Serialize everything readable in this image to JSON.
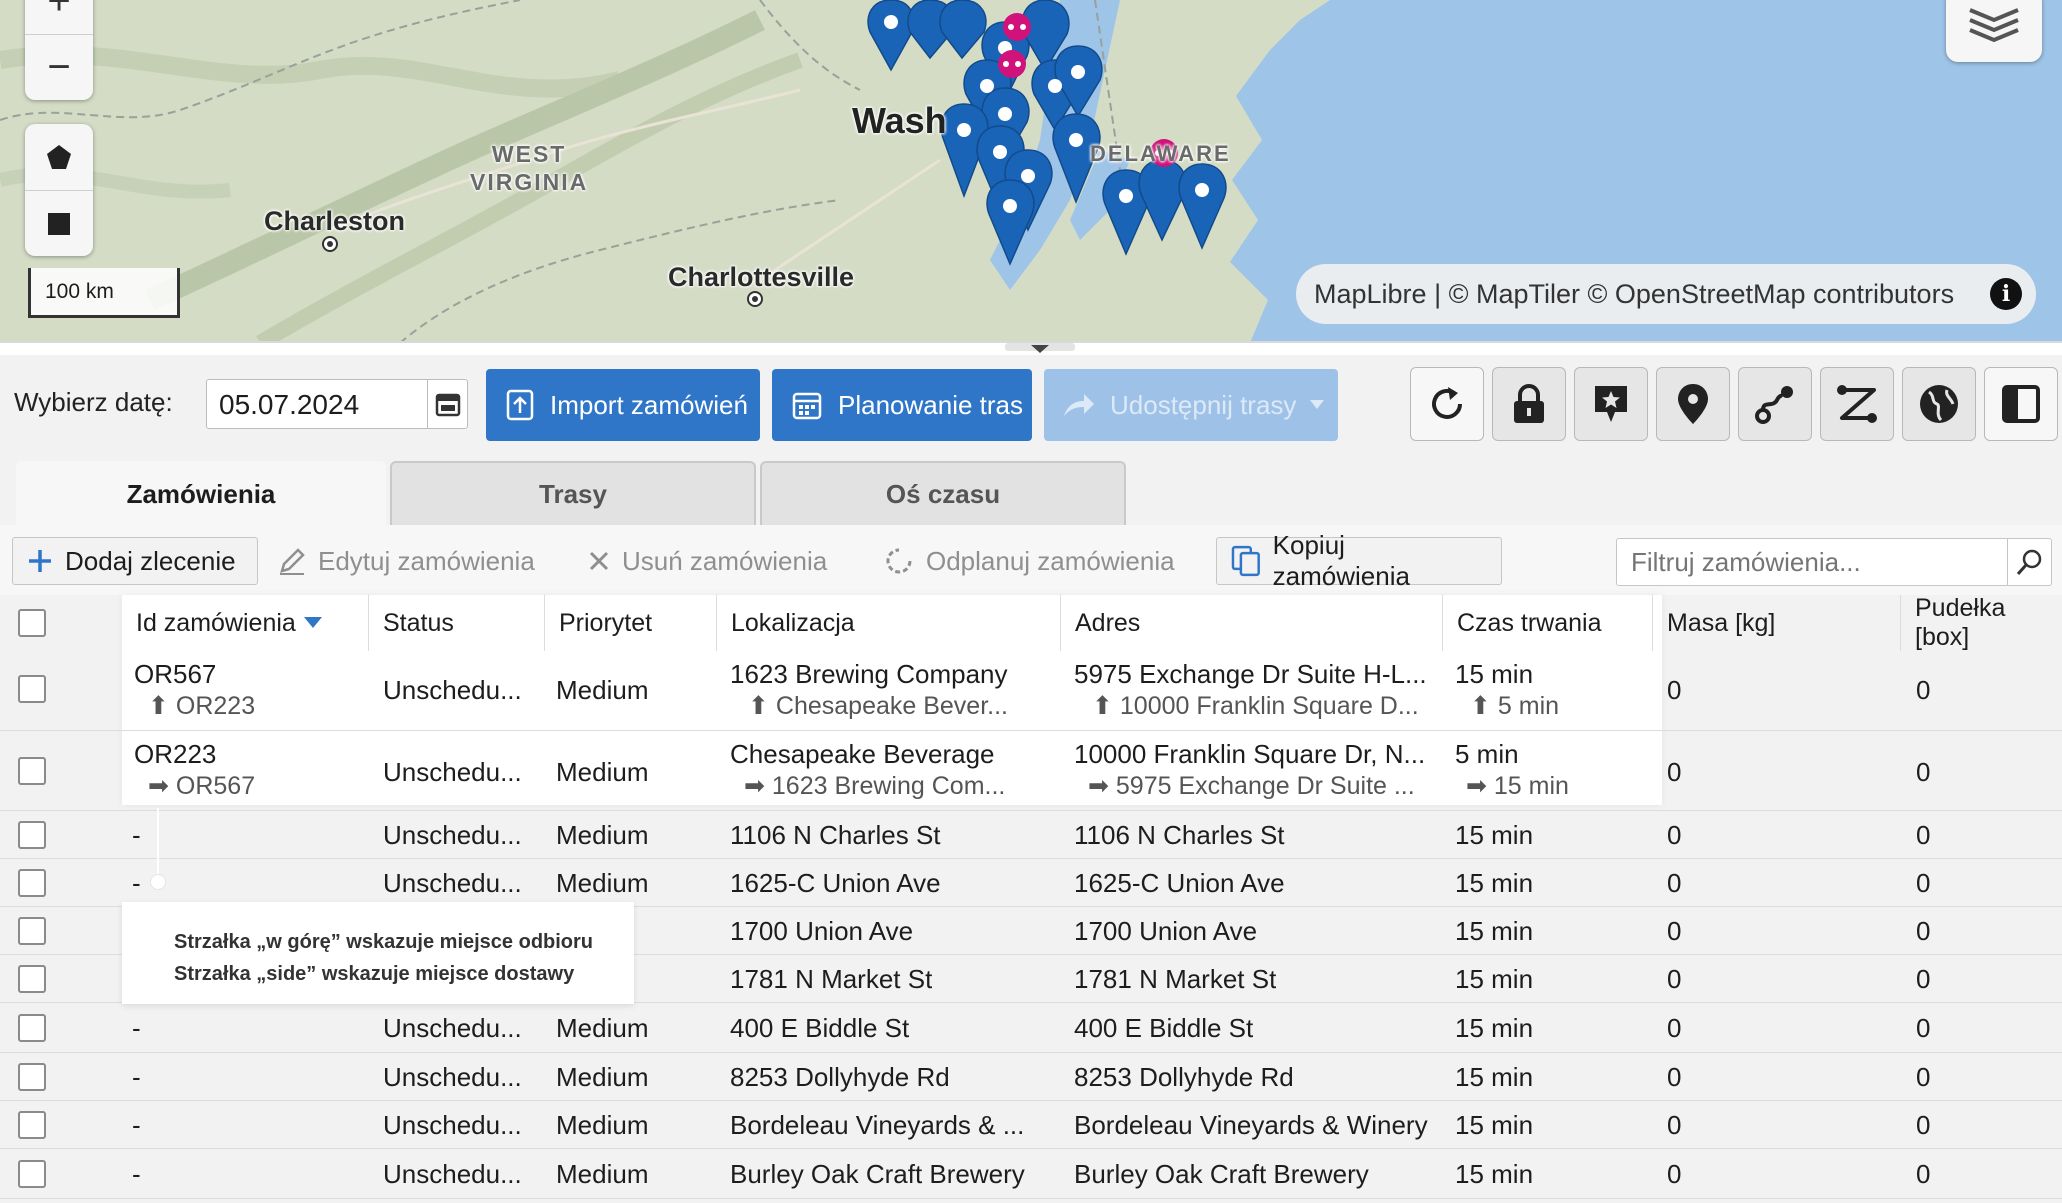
{
  "map": {
    "labels": {
      "state_wv": "WEST\nVIRGINIA",
      "charleston": "Charleston",
      "charlottesville": "Charlottesville",
      "washington": "Wash",
      "delaware": "DELAWARE"
    },
    "controls": {
      "zoom_in": "+",
      "zoom_out": "−"
    },
    "scale": "100 km",
    "attribution": "MapLibre | © MapTiler © OpenStreetMap contributors",
    "info_glyph": "i",
    "colors": {
      "water": "#9ec4e8",
      "land": "#d4dcc6",
      "pin": "#1a64b8",
      "cluster": "#d0127a"
    }
  },
  "toolbar": {
    "date_label": "Wybierz datę:",
    "date_value": "05.07.2024",
    "import_label": "Import zamówień",
    "plan_label": "Planowanie tras",
    "share_label": "Udostępnij trasy",
    "icons": [
      "refresh-icon",
      "lock-icon",
      "star-marker-icon",
      "pin-icon",
      "route-icon",
      "route-branch-icon",
      "globe-icon",
      "panel-toggle-icon"
    ]
  },
  "tabs": [
    "Zamówienia",
    "Trasy",
    "Oś czasu"
  ],
  "actions": {
    "add": "Dodaj zlecenie",
    "edit": "Edytuj zamówienia",
    "delete": "Usuń zamówienia",
    "unplan": "Odplanuj zamówienia",
    "copy": "Kopiuj zamówienia",
    "filter_placeholder": "Filtruj zamówienia..."
  },
  "table": {
    "columns": [
      "Id zamówienia",
      "Status",
      "Priorytet",
      "Lokalizacja",
      "Adres",
      "Czas trwania",
      "Masa [kg]",
      "Pudełka [box]"
    ],
    "linked_rows": [
      {
        "id": "OR567",
        "id_sub": "OR223",
        "status": "Unschedu...",
        "priority": "Medium",
        "location": "1623 Brewing Company",
        "location_sub": "Chesapeake Bever...",
        "address": "5975 Exchange Dr Suite H-L...",
        "address_sub": "10000 Franklin Square D...",
        "duration": "15 min",
        "duration_sub": "5 min",
        "mass": "0",
        "boxes": "0"
      },
      {
        "id": "OR223",
        "id_sub": "OR567",
        "status": "Unschedu...",
        "priority": "Medium",
        "location": "Chesapeake Beverage",
        "location_sub": "1623 Brewing Com...",
        "address": "10000 Franklin Square Dr, N...",
        "address_sub": "5975 Exchange Dr Suite ...",
        "duration": "5 min",
        "duration_sub": "15 min",
        "mass": "0",
        "boxes": "0"
      }
    ],
    "rows": [
      {
        "id": "-",
        "status": "Unschedu...",
        "priority": "Medium",
        "location": "1106 N Charles St",
        "address": "1106 N Charles St",
        "duration": "15 min",
        "mass": "0",
        "boxes": "0"
      },
      {
        "id": "-",
        "status": "Unschedu...",
        "priority": "Medium",
        "location": "1625-C Union Ave",
        "address": "1625-C Union Ave",
        "duration": "15 min",
        "mass": "0",
        "boxes": "0"
      },
      {
        "id": "",
        "status": "",
        "priority": "",
        "location": "1700 Union Ave",
        "address": "1700 Union Ave",
        "duration": "15 min",
        "mass": "0",
        "boxes": "0"
      },
      {
        "id": "",
        "status": "",
        "priority": "",
        "location": "1781 N Market St",
        "address": "1781 N Market St",
        "duration": "15 min",
        "mass": "0",
        "boxes": "0"
      },
      {
        "id": "-",
        "status": "Unschedu...",
        "priority": "Medium",
        "location": "400 E Biddle St",
        "address": "400 E Biddle St",
        "duration": "15 min",
        "mass": "0",
        "boxes": "0"
      },
      {
        "id": "-",
        "status": "Unschedu...",
        "priority": "Medium",
        "location": "8253 Dollyhyde Rd",
        "address": "8253 Dollyhyde Rd",
        "duration": "15 min",
        "mass": "0",
        "boxes": "0"
      },
      {
        "id": "-",
        "status": "Unschedu...",
        "priority": "Medium",
        "location": "Bordeleau Vineyards & ...",
        "address": "Bordeleau Vineyards & Winery",
        "duration": "15 min",
        "mass": "0",
        "boxes": "0"
      },
      {
        "id": "-",
        "status": "Unschedu...",
        "priority": "Medium",
        "location": "Burley Oak Craft Brewery",
        "address": "Burley Oak Craft Brewery",
        "duration": "15 min",
        "mass": "0",
        "boxes": "0"
      }
    ]
  },
  "annotation": {
    "line1": "Strzałka „w górę” wskazuje miejsce odbioru",
    "line2": "Strzałka „side” wskazuje miejsce dostawy"
  }
}
